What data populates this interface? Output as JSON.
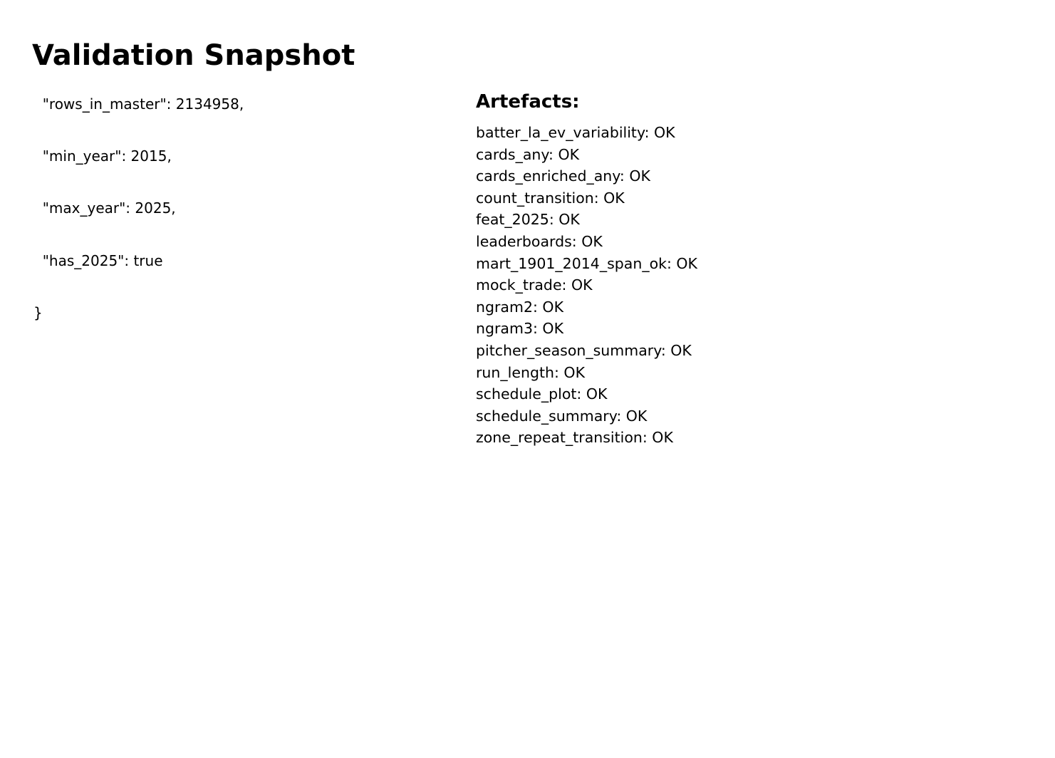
{
  "page_title": "Validation Snapshot",
  "summary_json_lines": [
    "{",
    "  \"rows_in_master\": 2134958,",
    "  \"min_year\": 2015,",
    "  \"max_year\": 2025,",
    "  \"has_2025\": true",
    "}"
  ],
  "artefacts": {
    "heading": "Artefacts:",
    "items": [
      "batter_la_ev_variability: OK",
      "cards_any: OK",
      "cards_enriched_any: OK",
      "count_transition: OK",
      "feat_2025: OK",
      "leaderboards: OK",
      "mart_1901_2014_span_ok: OK",
      "mock_trade: OK",
      "ngram2: OK",
      "ngram3: OK",
      "pitcher_season_summary: OK",
      "run_length: OK",
      "schedule_plot: OK",
      "schedule_summary: OK",
      "zone_repeat_transition: OK"
    ]
  }
}
